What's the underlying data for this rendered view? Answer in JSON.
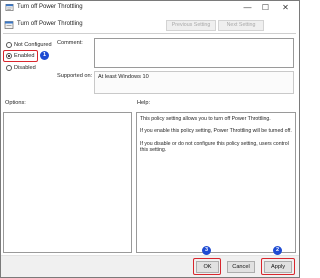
{
  "window": {
    "title": "Turn off Power Throttling",
    "minimize_glyph": "—",
    "maximize_glyph": "☐",
    "close_glyph": "✕"
  },
  "header": {
    "title": "Turn off Power Throttling",
    "previous_setting": "Previous Setting",
    "next_setting": "Next Setting"
  },
  "options": {
    "not_configured": "Not Configured",
    "enabled": "Enabled",
    "disabled": "Disabled",
    "selected": "Enabled"
  },
  "comment": {
    "label": "Comment:",
    "value": ""
  },
  "supported_on": {
    "label": "Supported on:",
    "value": "At least Windows 10"
  },
  "options_label": "Options:",
  "help_label": "Help:",
  "help_text": [
    "This policy setting allows you to turn off Power Throttling.",
    "If you enable this policy setting, Power Throttling will be turned off.",
    "If you disable or do not configure this policy setting, users control this setting."
  ],
  "buttons": {
    "ok": "OK",
    "cancel": "Cancel",
    "apply": "Apply"
  },
  "annotations": {
    "step1": "1",
    "step2": "2",
    "step3": "3"
  },
  "colors": {
    "highlight": "#d8262d",
    "badge": "#1e4bd2"
  },
  "icons": {
    "app": "policy-icon"
  }
}
